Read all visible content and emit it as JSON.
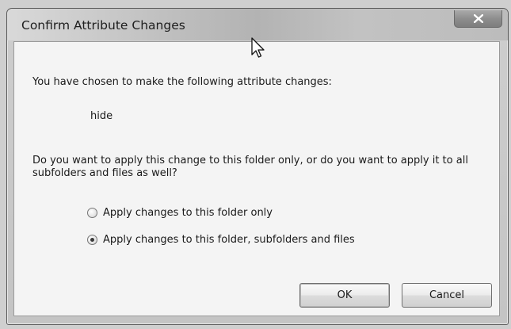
{
  "dialog": {
    "title": "Confirm Attribute Changes",
    "intro": "You have chosen to make the following attribute changes:",
    "attribute": "hide",
    "question": "Do you want to apply this change to this folder only, or do you want to apply it to all subfolders and files as well?",
    "options": [
      {
        "label": "Apply changes to this folder only",
        "selected": false
      },
      {
        "label": "Apply changes to this folder, subfolders and files",
        "selected": true
      }
    ],
    "ok_label": "OK",
    "cancel_label": "Cancel"
  },
  "icons": {
    "close": "close-icon",
    "cursor": "mouse-pointer-icon"
  }
}
